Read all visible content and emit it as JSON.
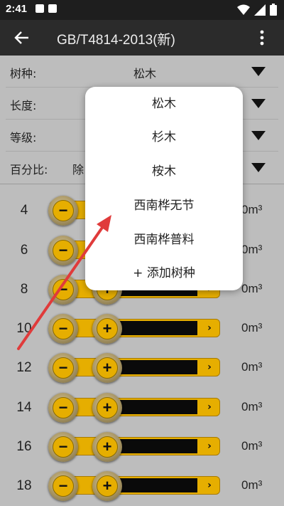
{
  "status_bar": {
    "time": "2:41"
  },
  "app_bar": {
    "title": "GB/T4814-2013(新)"
  },
  "form": {
    "rows": [
      {
        "label": "树种:",
        "value": "松木"
      },
      {
        "label": "长度:",
        "value": ""
      },
      {
        "label": "等级:",
        "value": ""
      },
      {
        "label": "百分比:",
        "value": "除"
      }
    ]
  },
  "list": {
    "rows": [
      {
        "diameter": "4",
        "volume": "0m³"
      },
      {
        "diameter": "6",
        "volume": "0m³"
      },
      {
        "diameter": "8",
        "volume": "0m³"
      },
      {
        "diameter": "10",
        "volume": "0m³"
      },
      {
        "diameter": "12",
        "volume": "0m³"
      },
      {
        "diameter": "14",
        "volume": "0m³"
      },
      {
        "diameter": "16",
        "volume": "0m³"
      },
      {
        "diameter": "18",
        "volume": "0m³"
      }
    ],
    "minus_symbol": "−",
    "plus_symbol": "+",
    "arrow_symbol": "›"
  },
  "dropdown": {
    "items": [
      "松木",
      "杉木",
      "桉木",
      "西南桦无节",
      "西南桦普料",
      "+ 添加树种"
    ]
  },
  "colors": {
    "accent": "#e6ae00",
    "annotation_arrow": "#e03b3b"
  },
  "icons": {
    "back": "back-arrow-icon",
    "more": "more-vert-icon",
    "dropdown": "dropdown-triangle-icon"
  }
}
